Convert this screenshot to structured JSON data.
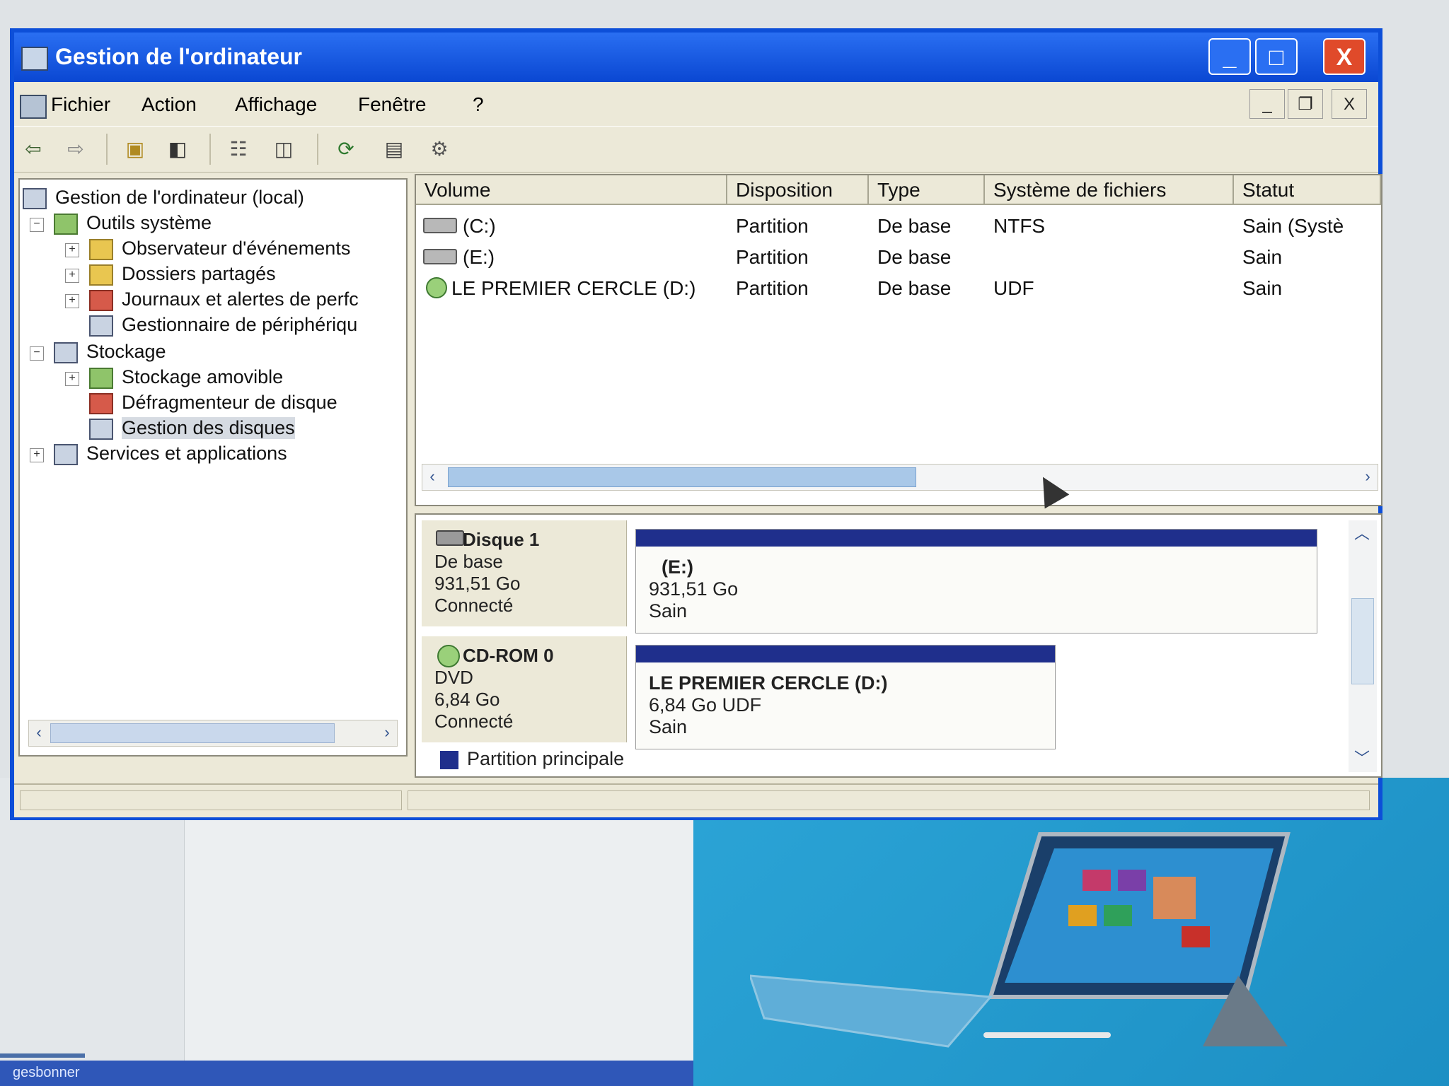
{
  "window": {
    "title": "Gestion de l'ordinateur"
  },
  "caption_buttons": {
    "minimize": "_",
    "maximize": "□",
    "close": "X"
  },
  "menu": {
    "items": [
      "Fichier",
      "Action",
      "Affichage",
      "Fenêtre",
      "?"
    ]
  },
  "mdi_buttons": {
    "minimize": "_",
    "restore": "❐",
    "close": "X"
  },
  "toolbar": {
    "icons": [
      "back-arrow-icon",
      "forward-arrow-icon",
      "up-folder-icon",
      "show-hide-tree-icon",
      "properties-icon",
      "export-list-icon",
      "refresh-icon",
      "help-icon",
      "settings-icon"
    ]
  },
  "tree": {
    "root": "Gestion de l'ordinateur (local)",
    "system_tools": "Outils système",
    "event_viewer": "Observateur d'événements",
    "shared_folders": "Dossiers partagés",
    "perf_logs": "Journaux et alertes de perfc",
    "device_manager": "Gestionnaire de périphériqu",
    "storage": "Stockage",
    "removable_storage": "Stockage amovible",
    "defragmenter": "Défragmenteur de disque",
    "disk_management": "Gestion des disques",
    "services_apps": "Services et applications"
  },
  "volumes": {
    "columns": {
      "volume": "Volume",
      "layout": "Disposition",
      "type": "Type",
      "filesystem": "Système de fichiers",
      "status": "Statut"
    },
    "rows": [
      {
        "volume": "(C:)",
        "layout": "Partition",
        "type": "De base",
        "filesystem": "NTFS",
        "status": "Sain (Systè"
      },
      {
        "volume": "(E:)",
        "layout": "Partition",
        "type": "De base",
        "filesystem": "",
        "status": "Sain"
      },
      {
        "volume": "LE PREMIER CERCLE (D:)",
        "layout": "Partition",
        "type": "De base",
        "filesystem": "UDF",
        "status": "Sain"
      }
    ]
  },
  "disks": [
    {
      "title": "Disque 1",
      "type": "De base",
      "size": "931,51 Go",
      "state": "Connecté",
      "partition": {
        "name": "(E:)",
        "line1": "931,51 Go",
        "line2": "Sain"
      }
    },
    {
      "title": "CD-ROM 0",
      "type": "DVD",
      "size": "6,84 Go",
      "state": "Connecté",
      "partition": {
        "name": "LE PREMIER CERCLE  (D:)",
        "line1": "6,84 Go UDF",
        "line2": "Sain"
      }
    }
  ],
  "legend": {
    "primary_partition": "Partition principale",
    "color": "#1f2f8c"
  },
  "taskbar": {
    "label": "gesbonner"
  },
  "colors": {
    "title_bar": "#0a47d2",
    "window_bg": "#ece9d8",
    "ad_bg": "#2ba4d6"
  }
}
